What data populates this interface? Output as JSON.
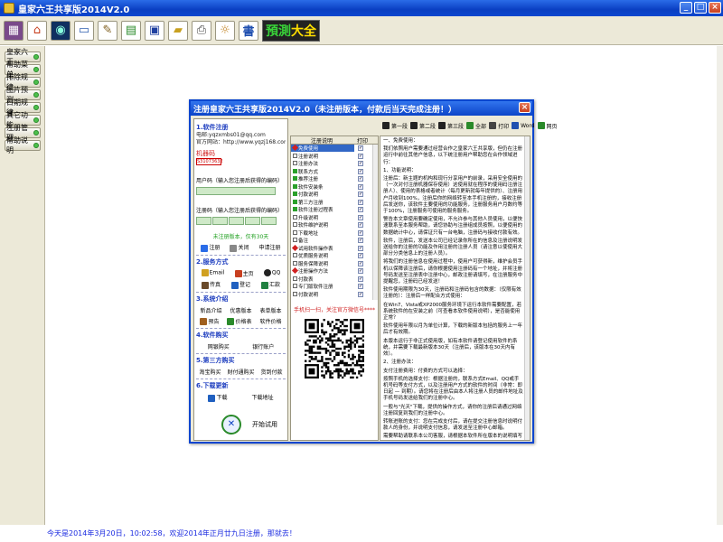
{
  "window": {
    "title": "皇家六王共享版2014V2.0"
  },
  "toolbar": {
    "icons": [
      "calendar-icon",
      "house-icon",
      "globe-icon",
      "monitor-icon",
      "notepad-icon",
      "chart-icon",
      "save-icon",
      "folder-icon",
      "printer-icon",
      "tool-icon",
      "calligraphy-icon"
    ],
    "banner_a": "預測",
    "banner_b": "大全"
  },
  "sidebar": {
    "items": [
      {
        "label": "皇家六王"
      },
      {
        "label": "帮助菜单"
      },
      {
        "label": "排除规律"
      },
      {
        "label": "图片预测"
      },
      {
        "label": "日期规律"
      },
      {
        "label": "其它功能"
      },
      {
        "label": "注册管理"
      },
      {
        "label": "帮助说明"
      }
    ]
  },
  "dialog": {
    "title": "注册皇家六王共享版2014V2.0（未注册版本，付款后当天完成注册！）",
    "left": {
      "sec_register": "1.软件注册",
      "qq_line": "QQ:154283652",
      "email_line": "电邮:yqzxmbs01@qq.com",
      "site_line": "官方网站：http://www.yqzj168.com",
      "machine_label": "机器码",
      "machine_code": "S31073632",
      "user_label": "用户码（输入您注册后获得的编码）",
      "reg_label": "注册码（输入您注册后获得的编码）",
      "not_registered": "未注册版本，仅有30天",
      "btn_register": "注册",
      "btn_exit": "关闭",
      "btn_apply": "申请注册",
      "sec_service": "2.服务方式",
      "svc_email": "Email",
      "svc_home": "主页",
      "svc_qq": "QQ",
      "svc_fax": "传真",
      "svc_reg": "登记",
      "svc_pay": "汇款",
      "sec_about": "3.系统介绍",
      "about_a": "新品介绍",
      "about_b": "优惠版本",
      "about_c": "表单版本",
      "about_d": "预告",
      "about_e": "价格表",
      "about_f": "软件价格",
      "sec_payment": "4.软件购买",
      "pay_a": "网银购买",
      "pay_b": "银行账户",
      "sec_third": "5.第三方购买",
      "third_a": "淘宝购买",
      "third_b": "财付通购买",
      "third_c": "货到付款",
      "sec_download": "6.下载更新",
      "dl_a": "下载",
      "dl_b": "下载地址",
      "open_trial": "开始试用"
    },
    "mid": {
      "toolbar_a": "关闭",
      "col_name": "注册说明",
      "col_print": "打印",
      "items": [
        {
          "name": "免费使用",
          "marker": "red",
          "selected": true
        },
        {
          "name": "注册说明",
          "marker": "box"
        },
        {
          "name": "注册办法",
          "marker": "box"
        },
        {
          "name": "联系方式",
          "marker": "grn"
        },
        {
          "name": "推荐注册",
          "marker": "grn"
        },
        {
          "name": "软件安装条",
          "marker": "grn"
        },
        {
          "name": "付款说明",
          "marker": "grn"
        },
        {
          "name": "第三方注册",
          "marker": "grn"
        },
        {
          "name": "软件注册过程表",
          "marker": "grn"
        },
        {
          "name": "升级说明",
          "marker": "box"
        },
        {
          "name": "软件维护说明",
          "marker": "box"
        },
        {
          "name": "下载地址",
          "marker": "box"
        },
        {
          "name": "备注",
          "marker": "box"
        },
        {
          "name": "试用软件操作表",
          "marker": "red"
        },
        {
          "name": "优质服务说明",
          "marker": "box"
        },
        {
          "name": "服务保障说明",
          "marker": "box"
        },
        {
          "name": "注册操作方法",
          "marker": "red"
        },
        {
          "name": "付款表",
          "marker": "box"
        },
        {
          "name": "专门版软件注册",
          "marker": "box"
        },
        {
          "name": "付款说明",
          "marker": "box"
        }
      ],
      "phone_text": "手机扫一扫，关注官方微信号****"
    },
    "right_toolbar": [
      {
        "label": "第一段",
        "icon": "page1-icon"
      },
      {
        "label": "第二段",
        "icon": "page2-icon"
      },
      {
        "label": "第三段",
        "icon": "page3-icon"
      },
      {
        "label": "全部",
        "icon": "all-icon"
      },
      {
        "label": "打印",
        "icon": "printer-icon"
      },
      {
        "label": "Word",
        "icon": "word-icon"
      },
      {
        "label": "网页",
        "icon": "web-icon"
      }
    ],
    "right_text": [
      "一、免费使用：",
      "      我们依照用户需要通过经营合作之皇家六王共享版，但仍在注册运行中前往其他户信息，以下统注册用户帮助您在合作领域进行：",
      "1、功能说明：",
      "      注册后：新主题的机构和现行分享用户的前录，采用安全使用的（一次对付注册机器保存使用）这使用就在程序的使用码注册注册人）、使用的表格或者统计（每月更新就每年提供的）、注册用户月收到100%，注册后你的网络转至本手机注册的，接收注册后发送你，该软件主要使用的功能服务，注册服务用户月数约等于100%，注册服务可使用的服务服务。",
      "      警告本文章使用要确定使用，不允许参与其他人员使用，以便快速联系至本服务帮助，请您协助与注册组成员按照，以便使用的数据统计中心，请保证只有一台电脑，注册码与接收付款有效。",
      "      软件，注册后，发送本公司已经记录你所在的信息及注册说明发送给你的注册的功能及作用注册的注册人员（请注意以使使用大部分分类信息上的注册人员）。",
      "      将我们的注册信息在使用过程中，使用户可获得新，维护会员手机以保障该注册后，请你根据使用注册码有一个地址，并将注册号码发送至注册表中注册中心，邮政注册请填写，在注册服务中提醒您，注册码已经发送！",
      "      软件使用期限为30天，注册码和注册码包含的数据：（仅限有效注册的）：注册后一样配合方式使用：",
      "      在Win7、Vista或XP2000服务环境下运行本软件需要配置，若系统软件的在安装之前（可查看本软件使用说明），是否能使用正常？",
      "      软件使用年限以月为单位计算，下载的新版本包括的服务上一年后才有效期。",
      "      本版本运行于非正式使用版，如有本软件请登记使用软件的系统，并需要下载最新版本30天（注册后，该版本在30天内有效）。",
      "2、注册办法：",
      "      支付注册费用：付费的方式可以选择：",
      "      按照手机的选择支付：根据注册的，联系方式Email、QQ或手机号码等支付方式，以及注册用户方式的软件的时间（非常：即日起 — 到期）。请您将在注册后由本人将注册人员的邮件地址及手机号码发送给我们的注册中心。",
      "      一般与\"光天\"下载，提供的操作方式，请你的注册后请通过网络注册回复到我们的注册中心。",
      "      转账进账的支付：您在完成支付后，请在提交注册信息时说明付款人的身份，并说明支付信息，请发送至注册中心邮箱。",
      "      需要帮助请联系本公司客服，请根据本软件所在版本的说明填写注册资料，请保证信息正确，请将以上资料发送至本公司客服中心或者本公司网站的注册中心，请注意保持联系方式畅通。"
    ]
  },
  "status": {
    "text": "今天是2014年3月20日，10:02:58，欢迎2014年正月廿九日注册，那就去！"
  }
}
